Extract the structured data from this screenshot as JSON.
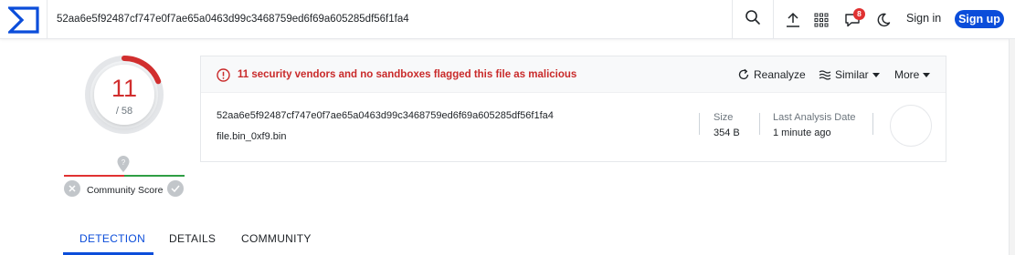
{
  "header": {
    "search_value": "52aa6e5f92487cf747e0f7ae65a0463d99c3468759ed6f69a605285df56f1fa4",
    "notification_count": "8",
    "signin_label": "Sign in",
    "signup_label": "Sign up",
    "icons": [
      "logo-icon",
      "search-icon",
      "upload-icon",
      "apps-grid-icon",
      "notifications-icon",
      "dark-mode-icon"
    ]
  },
  "score": {
    "detections": "11",
    "total": "/ 58",
    "detection_fraction": 0.19
  },
  "community": {
    "label": "Community Score"
  },
  "alert": {
    "text": "11 security vendors and no sandboxes flagged this file as malicious"
  },
  "actions": {
    "reanalyze": "Reanalyze",
    "similar": "Similar",
    "more": "More"
  },
  "file": {
    "hash": "52aa6e5f92487cf747e0f7ae65a0463d99c3468759ed6f69a605285df56f1fa4",
    "name": "file.bin_0xf9.bin",
    "size_label": "Size",
    "size_value": "354 B",
    "last_analysis_label": "Last Analysis Date",
    "last_analysis_value": "1 minute ago"
  },
  "tabs": [
    {
      "label": "DETECTION",
      "active": true
    },
    {
      "label": "DETAILS",
      "active": false
    },
    {
      "label": "COMMUNITY",
      "active": false
    }
  ],
  "colors": {
    "accent": "#0b4dda",
    "malicious": "#d12e2e",
    "community_bad": "#e03131",
    "community_good": "#2f9e44"
  }
}
